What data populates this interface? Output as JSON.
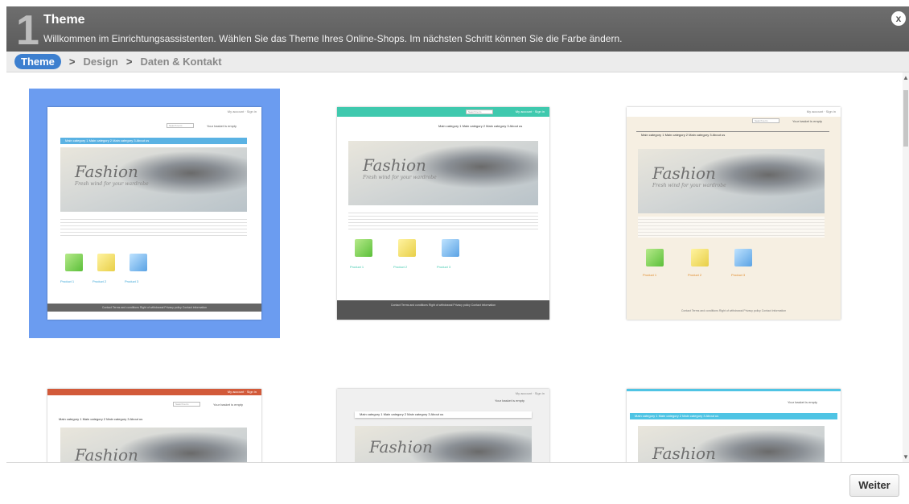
{
  "header": {
    "step_number": "1",
    "title": "Theme",
    "description": "Willkommen im Einrichtungsassistenten. Wählen Sie das Theme Ihres Online-Shops. Im nächsten Schritt können Sie die Farbe ändern.",
    "close_label": "x"
  },
  "breadcrumb": {
    "items": [
      "Theme",
      "Design",
      "Daten & Kontakt"
    ],
    "separator": ">",
    "active_index": 0
  },
  "preview": {
    "top_links": "My account · Sign in",
    "search_placeholder": "Search term",
    "cart_text": "Your basket is empty",
    "nav": "Main category 1   Main category 2   Main category 3   About us",
    "nav_plain": "Main category 1  Main category 2  Main category 3  About us",
    "hero_title": "Fashion",
    "hero_tagline": "Fresh wind for your wardrobe",
    "products": [
      "Product 1",
      "Product 2",
      "Product 3"
    ],
    "footer": "Contact  Terms and conditions  Right of withdrawal  Privacy policy  Contact information"
  },
  "themes": [
    {
      "id": "theme-1",
      "selected": true
    },
    {
      "id": "theme-2",
      "selected": false
    },
    {
      "id": "theme-3",
      "selected": false
    },
    {
      "id": "theme-4",
      "selected": false
    },
    {
      "id": "theme-5",
      "selected": false
    },
    {
      "id": "theme-6",
      "selected": false
    }
  ],
  "footer_bar": {
    "next_label": "Weiter"
  },
  "colors": {
    "header_bg": "#5f5f5f",
    "accent_blue": "#3c7fcf",
    "selected_bg": "#6b9cf0",
    "teal": "#3fc9ae",
    "red": "#d25a3a",
    "cyan": "#4fc4e4"
  }
}
